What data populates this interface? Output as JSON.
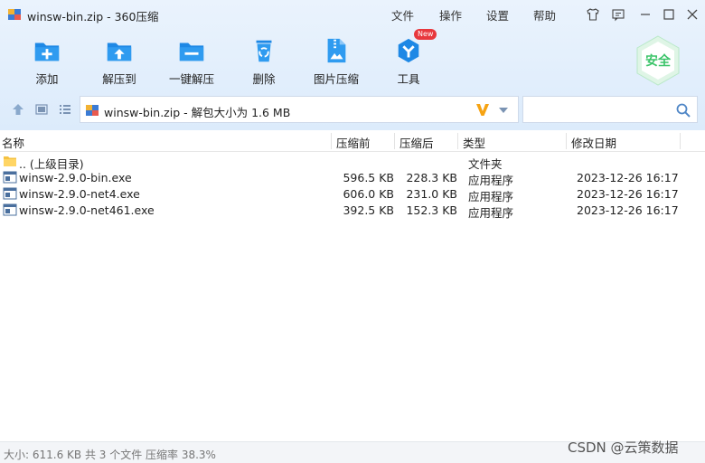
{
  "window": {
    "title": "winsw-bin.zip - 360压缩"
  },
  "menu": {
    "file": "文件",
    "operate": "操作",
    "settings": "设置",
    "help": "帮助"
  },
  "toolbar": {
    "items": [
      {
        "label": "添加",
        "icon": "add-folder-icon"
      },
      {
        "label": "解压到",
        "icon": "extract-folder-icon"
      },
      {
        "label": "一键解压",
        "icon": "one-click-extract-icon"
      },
      {
        "label": "删除",
        "icon": "recycle-delete-icon"
      },
      {
        "label": "图片压缩",
        "icon": "image-compress-icon"
      },
      {
        "label": "工具",
        "icon": "tools-icon",
        "badge": "New"
      }
    ],
    "safe_badge": "安全"
  },
  "path": {
    "text": "winsw-bin.zip - 解包大小为 1.6 MB"
  },
  "search": {
    "placeholder": ""
  },
  "columns": {
    "name": "名称",
    "compressed_before": "压缩前",
    "compressed_after": "压缩后",
    "type": "类型",
    "modified": "修改日期"
  },
  "rows": [
    {
      "name": ".. (上级目录)",
      "before": "",
      "after": "",
      "type": "文件夹",
      "date": "",
      "icon": "folder-icon"
    },
    {
      "name": "winsw-2.9.0-bin.exe",
      "before": "596.5 KB",
      "after": "228.3 KB",
      "type": "应用程序",
      "date": "2023-12-26 16:17",
      "icon": "exe-file-icon"
    },
    {
      "name": "winsw-2.9.0-net4.exe",
      "before": "606.0 KB",
      "after": "231.0 KB",
      "type": "应用程序",
      "date": "2023-12-26 16:17",
      "icon": "exe-file-icon"
    },
    {
      "name": "winsw-2.9.0-net461.exe",
      "before": "392.5 KB",
      "after": "152.3 KB",
      "type": "应用程序",
      "date": "2023-12-26 16:17",
      "icon": "exe-file-icon"
    }
  ],
  "status": {
    "text": "大小: 611.6 KB 共 3 个文件 压缩率 38.3%"
  },
  "watermark": "CSDN @云策数据",
  "colors": {
    "accent": "#1e88e5",
    "safe_green": "#3cc46a",
    "badge_red": "#e8383d"
  }
}
